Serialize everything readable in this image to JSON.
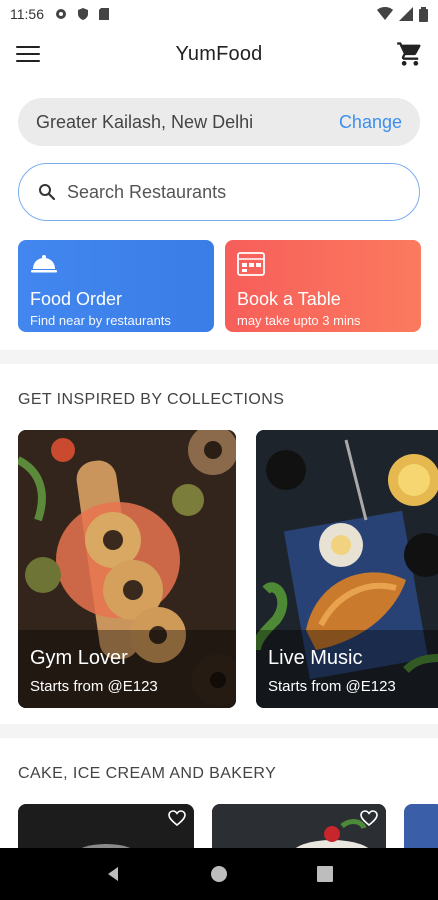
{
  "status_bar": {
    "time": "11:56"
  },
  "app_bar": {
    "title": "YumFood"
  },
  "location": {
    "text": "Greater Kailash, New Delhi",
    "change_label": "Change"
  },
  "search": {
    "placeholder": "Search Restaurants"
  },
  "actions": [
    {
      "title": "Food Order",
      "subtitle": "Find near by restaurants",
      "color": "#3f83ec"
    },
    {
      "title": "Book a Table",
      "subtitle": "may take upto 3 mins",
      "color": "#f96a5c"
    }
  ],
  "collections_section": {
    "title": "GET INSPIRED BY COLLECTIONS",
    "items": [
      {
        "title": "Gym Lover",
        "subtitle": "Starts from @E123"
      },
      {
        "title": "Live Music",
        "subtitle": "Starts from @E123"
      }
    ]
  },
  "bakery_section": {
    "title": "CAKE, ICE CREAM AND BAKERY"
  },
  "colors": {
    "accent": "#3b8ff0",
    "search_border": "#7aaef2"
  }
}
